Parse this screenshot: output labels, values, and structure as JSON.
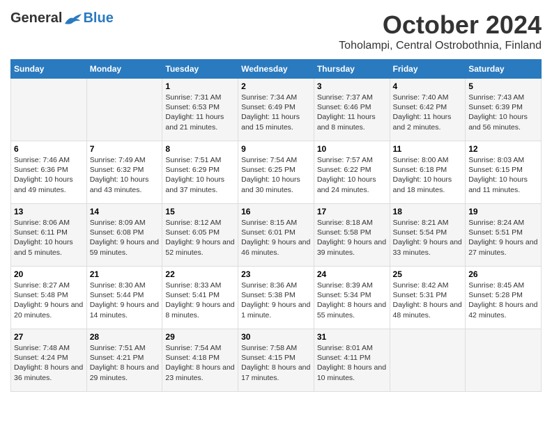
{
  "logo": {
    "general": "General",
    "blue": "Blue"
  },
  "title": "October 2024",
  "subtitle": "Toholampi, Central Ostrobothnia, Finland",
  "weekdays": [
    "Sunday",
    "Monday",
    "Tuesday",
    "Wednesday",
    "Thursday",
    "Friday",
    "Saturday"
  ],
  "weeks": [
    [
      {
        "day": "",
        "sunrise": "",
        "sunset": "",
        "daylight": ""
      },
      {
        "day": "",
        "sunrise": "",
        "sunset": "",
        "daylight": ""
      },
      {
        "day": "1",
        "sunrise": "Sunrise: 7:31 AM",
        "sunset": "Sunset: 6:53 PM",
        "daylight": "Daylight: 11 hours and 21 minutes."
      },
      {
        "day": "2",
        "sunrise": "Sunrise: 7:34 AM",
        "sunset": "Sunset: 6:49 PM",
        "daylight": "Daylight: 11 hours and 15 minutes."
      },
      {
        "day": "3",
        "sunrise": "Sunrise: 7:37 AM",
        "sunset": "Sunset: 6:46 PM",
        "daylight": "Daylight: 11 hours and 8 minutes."
      },
      {
        "day": "4",
        "sunrise": "Sunrise: 7:40 AM",
        "sunset": "Sunset: 6:42 PM",
        "daylight": "Daylight: 11 hours and 2 minutes."
      },
      {
        "day": "5",
        "sunrise": "Sunrise: 7:43 AM",
        "sunset": "Sunset: 6:39 PM",
        "daylight": "Daylight: 10 hours and 56 minutes."
      }
    ],
    [
      {
        "day": "6",
        "sunrise": "Sunrise: 7:46 AM",
        "sunset": "Sunset: 6:36 PM",
        "daylight": "Daylight: 10 hours and 49 minutes."
      },
      {
        "day": "7",
        "sunrise": "Sunrise: 7:49 AM",
        "sunset": "Sunset: 6:32 PM",
        "daylight": "Daylight: 10 hours and 43 minutes."
      },
      {
        "day": "8",
        "sunrise": "Sunrise: 7:51 AM",
        "sunset": "Sunset: 6:29 PM",
        "daylight": "Daylight: 10 hours and 37 minutes."
      },
      {
        "day": "9",
        "sunrise": "Sunrise: 7:54 AM",
        "sunset": "Sunset: 6:25 PM",
        "daylight": "Daylight: 10 hours and 30 minutes."
      },
      {
        "day": "10",
        "sunrise": "Sunrise: 7:57 AM",
        "sunset": "Sunset: 6:22 PM",
        "daylight": "Daylight: 10 hours and 24 minutes."
      },
      {
        "day": "11",
        "sunrise": "Sunrise: 8:00 AM",
        "sunset": "Sunset: 6:18 PM",
        "daylight": "Daylight: 10 hours and 18 minutes."
      },
      {
        "day": "12",
        "sunrise": "Sunrise: 8:03 AM",
        "sunset": "Sunset: 6:15 PM",
        "daylight": "Daylight: 10 hours and 11 minutes."
      }
    ],
    [
      {
        "day": "13",
        "sunrise": "Sunrise: 8:06 AM",
        "sunset": "Sunset: 6:11 PM",
        "daylight": "Daylight: 10 hours and 5 minutes."
      },
      {
        "day": "14",
        "sunrise": "Sunrise: 8:09 AM",
        "sunset": "Sunset: 6:08 PM",
        "daylight": "Daylight: 9 hours and 59 minutes."
      },
      {
        "day": "15",
        "sunrise": "Sunrise: 8:12 AM",
        "sunset": "Sunset: 6:05 PM",
        "daylight": "Daylight: 9 hours and 52 minutes."
      },
      {
        "day": "16",
        "sunrise": "Sunrise: 8:15 AM",
        "sunset": "Sunset: 6:01 PM",
        "daylight": "Daylight: 9 hours and 46 minutes."
      },
      {
        "day": "17",
        "sunrise": "Sunrise: 8:18 AM",
        "sunset": "Sunset: 5:58 PM",
        "daylight": "Daylight: 9 hours and 39 minutes."
      },
      {
        "day": "18",
        "sunrise": "Sunrise: 8:21 AM",
        "sunset": "Sunset: 5:54 PM",
        "daylight": "Daylight: 9 hours and 33 minutes."
      },
      {
        "day": "19",
        "sunrise": "Sunrise: 8:24 AM",
        "sunset": "Sunset: 5:51 PM",
        "daylight": "Daylight: 9 hours and 27 minutes."
      }
    ],
    [
      {
        "day": "20",
        "sunrise": "Sunrise: 8:27 AM",
        "sunset": "Sunset: 5:48 PM",
        "daylight": "Daylight: 9 hours and 20 minutes."
      },
      {
        "day": "21",
        "sunrise": "Sunrise: 8:30 AM",
        "sunset": "Sunset: 5:44 PM",
        "daylight": "Daylight: 9 hours and 14 minutes."
      },
      {
        "day": "22",
        "sunrise": "Sunrise: 8:33 AM",
        "sunset": "Sunset: 5:41 PM",
        "daylight": "Daylight: 9 hours and 8 minutes."
      },
      {
        "day": "23",
        "sunrise": "Sunrise: 8:36 AM",
        "sunset": "Sunset: 5:38 PM",
        "daylight": "Daylight: 9 hours and 1 minute."
      },
      {
        "day": "24",
        "sunrise": "Sunrise: 8:39 AM",
        "sunset": "Sunset: 5:34 PM",
        "daylight": "Daylight: 8 hours and 55 minutes."
      },
      {
        "day": "25",
        "sunrise": "Sunrise: 8:42 AM",
        "sunset": "Sunset: 5:31 PM",
        "daylight": "Daylight: 8 hours and 48 minutes."
      },
      {
        "day": "26",
        "sunrise": "Sunrise: 8:45 AM",
        "sunset": "Sunset: 5:28 PM",
        "daylight": "Daylight: 8 hours and 42 minutes."
      }
    ],
    [
      {
        "day": "27",
        "sunrise": "Sunrise: 7:48 AM",
        "sunset": "Sunset: 4:24 PM",
        "daylight": "Daylight: 8 hours and 36 minutes."
      },
      {
        "day": "28",
        "sunrise": "Sunrise: 7:51 AM",
        "sunset": "Sunset: 4:21 PM",
        "daylight": "Daylight: 8 hours and 29 minutes."
      },
      {
        "day": "29",
        "sunrise": "Sunrise: 7:54 AM",
        "sunset": "Sunset: 4:18 PM",
        "daylight": "Daylight: 8 hours and 23 minutes."
      },
      {
        "day": "30",
        "sunrise": "Sunrise: 7:58 AM",
        "sunset": "Sunset: 4:15 PM",
        "daylight": "Daylight: 8 hours and 17 minutes."
      },
      {
        "day": "31",
        "sunrise": "Sunrise: 8:01 AM",
        "sunset": "Sunset: 4:11 PM",
        "daylight": "Daylight: 8 hours and 10 minutes."
      },
      {
        "day": "",
        "sunrise": "",
        "sunset": "",
        "daylight": ""
      },
      {
        "day": "",
        "sunrise": "",
        "sunset": "",
        "daylight": ""
      }
    ]
  ]
}
